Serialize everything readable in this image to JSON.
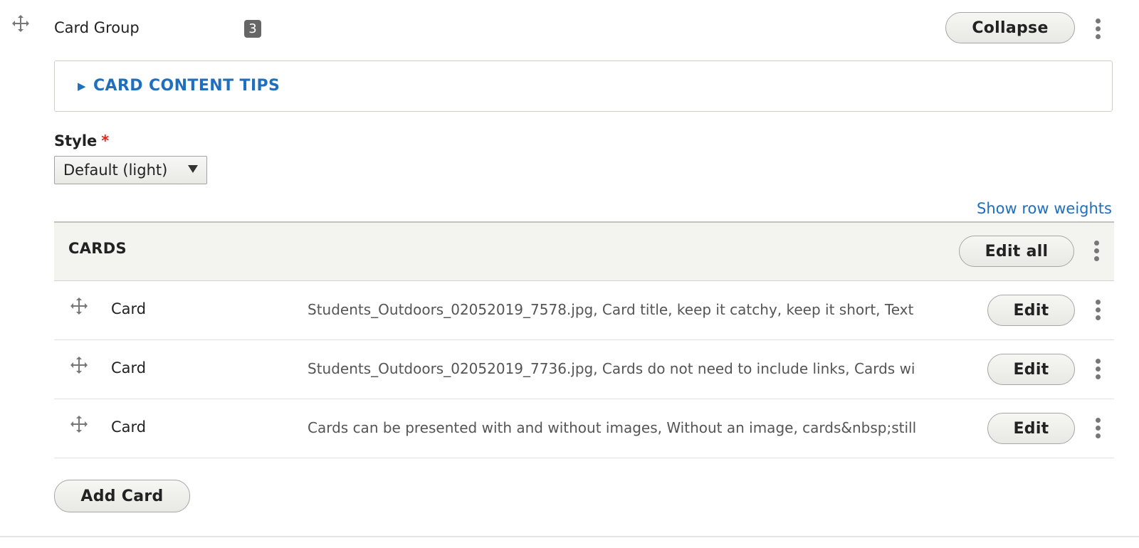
{
  "paragraph": {
    "title": "Card Group",
    "count_badge": "3",
    "collapse_label": "Collapse"
  },
  "tips": {
    "summary": "CARD CONTENT TIPS",
    "expanded": false
  },
  "style_field": {
    "label": "Style",
    "required_marker": "*",
    "selected": "Default (light)"
  },
  "table": {
    "show_row_weights_label": "Show row weights",
    "header": "CARDS",
    "edit_all_label": "Edit all",
    "rows": [
      {
        "label": "Card",
        "summary": "Students_Outdoors_02052019_7578.jpg, Card title, keep it catchy, keep it short, Text",
        "edit_label": "Edit"
      },
      {
        "label": "Card",
        "summary": "Students_Outdoors_02052019_7736.jpg, Cards do not need to include links, Cards wi",
        "edit_label": "Edit"
      },
      {
        "label": "Card",
        "summary": "Cards can be presented with and without images, Without an image, cards&nbsp;still",
        "edit_label": "Edit"
      }
    ],
    "add_label": "Add Card"
  },
  "colors": {
    "link": "#1f6fbf",
    "required": "#e1251b",
    "badge_bg": "#666666",
    "header_bg": "#f3f3ef"
  }
}
